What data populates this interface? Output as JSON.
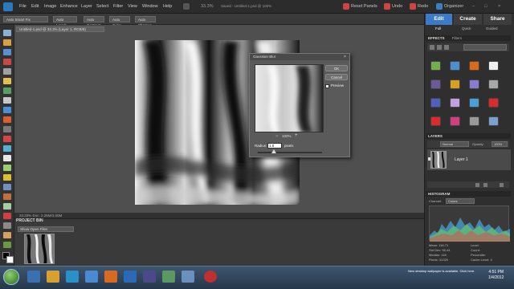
{
  "menubar": {
    "items": [
      "File",
      "Edit",
      "Image",
      "Enhance",
      "Layer",
      "Select",
      "Filter",
      "View",
      "Window",
      "Help"
    ],
    "zoom_readout": "33.3%",
    "doc_status": "Saved - Untitled-1.psd @ 100%",
    "right_links": {
      "reset": "Reset Panels",
      "undo": "Undo",
      "redo": "Redo",
      "organizer": "Organizer"
    }
  },
  "optionsbar": {
    "buttons": [
      "Auto Smart Fix",
      "Auto Levels",
      "Auto Contrast",
      "Auto Color",
      "Auto Sharpen"
    ]
  },
  "document": {
    "tab_title": "Untitled-1.psd @ 33.3% (Layer 1, RGB/8)"
  },
  "statusbar": {
    "text": "33.33%   Doc: 2.25M/3.00M"
  },
  "dialog": {
    "title": "Gaussian Blur",
    "close_glyph": "×",
    "ok_label": "OK",
    "cancel_label": "Cancel",
    "preview_label": "Preview",
    "zoom": "100%",
    "radius_label": "Radius:",
    "radius_value": "1.0",
    "radius_unit": "pixels",
    "slider_level": 0.25
  },
  "projectbin": {
    "header": "PROJECT BIN",
    "select_value": "Show Open Files"
  },
  "rightpanel": {
    "mode_tabs": [
      "Edit",
      "Create",
      "Share"
    ],
    "sub_tabs": [
      "Full",
      "Quick",
      "Guided"
    ],
    "effects_header": "EFFECTS",
    "effects_filter": "Filters",
    "layers_header": "LAYERS",
    "blend_mode": "Normal",
    "opacity_label": "Opacity:",
    "opacity_value": "100%",
    "layer_name": "Layer 1",
    "histogram_header": "HISTOGRAM",
    "channel_label": "Channel:",
    "channel_value": "Colors",
    "stats_left": [
      "Mean: 118.71",
      "Std Dev: 55.44",
      "Median: 118",
      "Pixels: 31320"
    ],
    "stats_right": [
      "Level:",
      "Count:",
      "Percentile:",
      "Cache Level: 4"
    ]
  },
  "effect_colors": [
    "#6fb04a",
    "#4a8fd0",
    "#d86a1a",
    "#f0f0f0",
    "#6a5a9a",
    "#d8a020",
    "#8a7ad0",
    "#a8a8a8",
    "#5060c0",
    "#c0a0e0",
    "#4a9fd8",
    "#dd2a2a",
    "#d04080",
    "#999999",
    "#7aa0d0",
    "#2f2f2f"
  ],
  "taskbar": {
    "notification": "New desktop wallpaper is available. Click here.",
    "time": "4:51 PM",
    "date": "1/4/2012"
  }
}
